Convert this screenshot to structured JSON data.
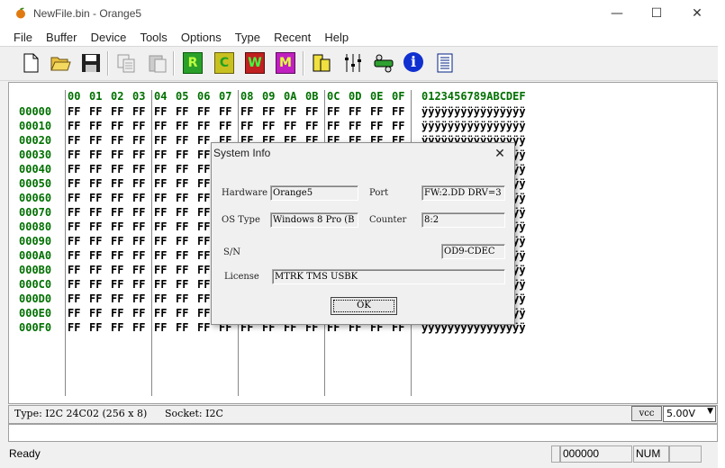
{
  "window": {
    "title": "NewFile.bin - Orange5"
  },
  "menu": [
    "File",
    "Buffer",
    "Device",
    "Tools",
    "Options",
    "Type",
    "Recent",
    "Help"
  ],
  "toolbar": {
    "read_label": "R",
    "check_label": "C",
    "write_label": "W",
    "mode_label": "M",
    "info_label": "i"
  },
  "hex": {
    "columns": [
      "00",
      "01",
      "02",
      "03",
      "04",
      "05",
      "06",
      "07",
      "08",
      "09",
      "0A",
      "0B",
      "0C",
      "0D",
      "0E",
      "0F"
    ],
    "ascii_header": "0123456789ABCDEF",
    "addresses": [
      "00000",
      "00010",
      "00020",
      "00030",
      "00040",
      "00050",
      "00060",
      "00070",
      "00080",
      "00090",
      "000A0",
      "000B0",
      "000C0",
      "000D0",
      "000E0",
      "000F0"
    ],
    "byte": "FF",
    "ascii_row": "ÿÿÿÿÿÿÿÿÿÿÿÿÿÿÿÿ"
  },
  "infobar": {
    "type": "Type: I2C 24C02 (256 x 8)",
    "socket": "Socket: I2C",
    "vcc_label": "vcc",
    "voltage": "5.00V"
  },
  "status": {
    "ready": "Ready",
    "offset": "000000",
    "num": "NUM"
  },
  "dialog": {
    "title": "System Info",
    "hardware_label": "Hardware",
    "hardware_value": "Orange5",
    "port_label": "Port",
    "port_value": "FW:2.DD DRV=3",
    "os_label": "OS Type",
    "os_value": "Windows 8 Pro (B",
    "counter_label": "Counter",
    "counter_value": "8:2",
    "sn_label": "S/N",
    "sn_value": "OD9-CDEC",
    "license_label": "License",
    "license_value": "MTRK TMS USBK",
    "ok_label": "OK"
  }
}
